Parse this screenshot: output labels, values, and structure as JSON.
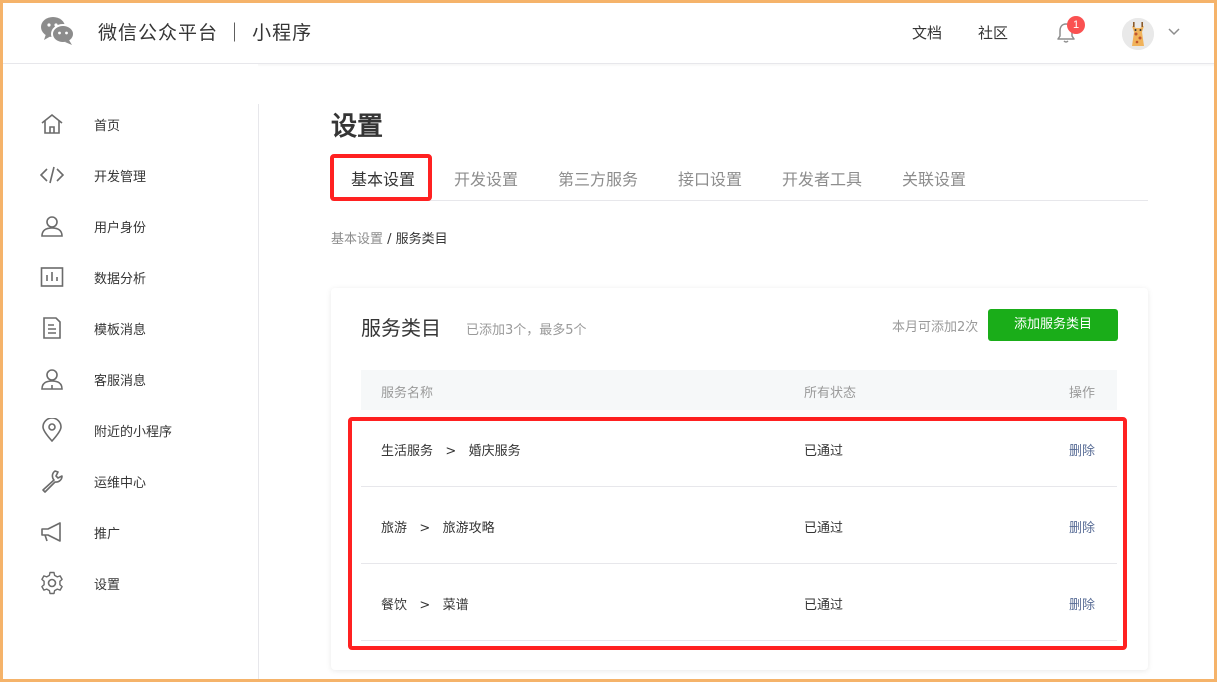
{
  "header": {
    "brand": "微信公众平台 ｜ 小程序",
    "links": [
      "文档",
      "社区"
    ],
    "notification_count": "1"
  },
  "sidebar": {
    "items": [
      {
        "label": "首页",
        "icon": "home-icon"
      },
      {
        "label": "开发管理",
        "icon": "code-icon"
      },
      {
        "label": "用户身份",
        "icon": "user-icon"
      },
      {
        "label": "数据分析",
        "icon": "chart-icon"
      },
      {
        "label": "模板消息",
        "icon": "document-icon"
      },
      {
        "label": "客服消息",
        "icon": "customer-service-icon"
      },
      {
        "label": "附近的小程序",
        "icon": "location-pin-icon"
      },
      {
        "label": "运维中心",
        "icon": "wrench-icon"
      },
      {
        "label": "推广",
        "icon": "megaphone-icon"
      },
      {
        "label": "设置",
        "icon": "gear-icon"
      }
    ]
  },
  "main": {
    "title": "设置",
    "tabs": [
      "基本设置",
      "开发设置",
      "第三方服务",
      "接口设置",
      "开发者工具",
      "关联设置"
    ],
    "active_tab": "基本设置",
    "breadcrumb": {
      "parent": "基本设置",
      "separator": " / ",
      "current": "服务类目"
    }
  },
  "card": {
    "title": "服务类目",
    "subtitle": "已添加3个，最多5个",
    "quota": "本月可添加2次",
    "add_button": "添加服务类目",
    "columns": [
      "服务名称",
      "所有状态",
      "操作"
    ],
    "rows": [
      {
        "name": "生活服务   >   婚庆服务",
        "status": "已通过",
        "action": "删除"
      },
      {
        "name": "旅游   >   旅游攻略",
        "status": "已通过",
        "action": "删除"
      },
      {
        "name": "餐饮   >   菜谱",
        "status": "已通过",
        "action": "删除"
      }
    ]
  },
  "colors": {
    "accent_green": "#1aad19",
    "link_blue": "#576b95",
    "highlight_red": "#ff2121",
    "badge_red": "#fa5151",
    "frame_orange": "#f5b36a"
  }
}
